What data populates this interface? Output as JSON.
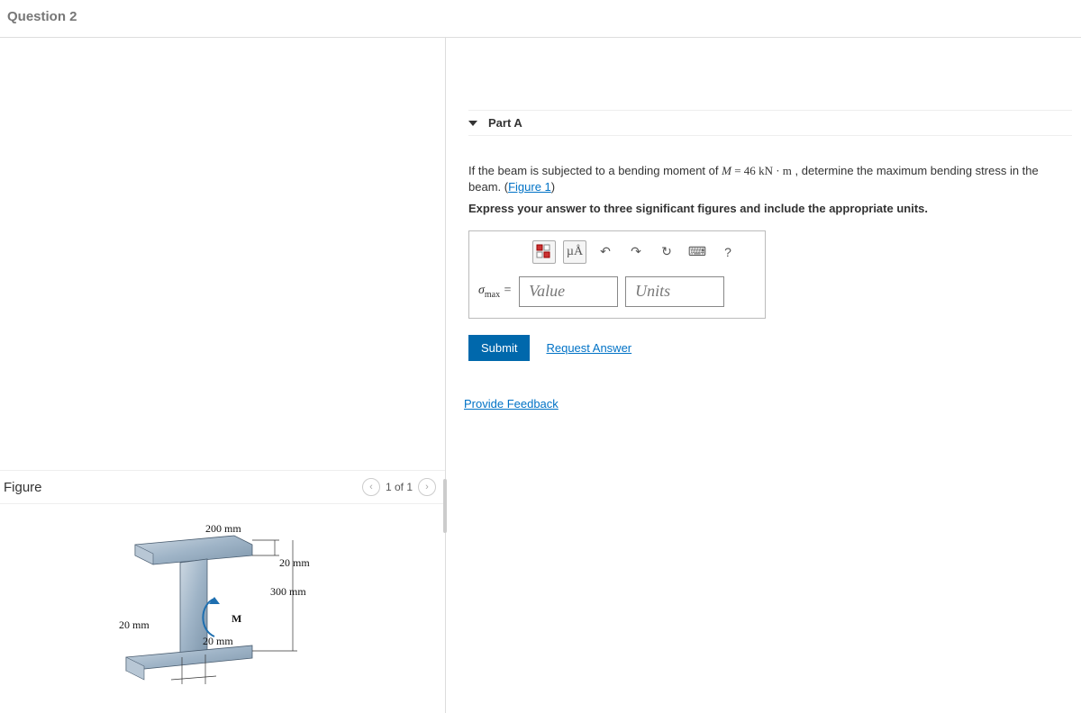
{
  "header": {
    "title": "Question 2"
  },
  "figure": {
    "title": "Figure",
    "pager": {
      "label": "1 of 1"
    },
    "dims": {
      "top_flange_width": "200 mm",
      "top_flange_thick": "20 mm",
      "web_height": "300 mm",
      "web_thick": "20 mm",
      "bottom_flange_left": "20 mm",
      "moment_label": "M"
    }
  },
  "part": {
    "title": "Part A",
    "prompt_pre": "If the beam is subjected to a bending moment of ",
    "prompt_M": "M",
    "prompt_eq": " = 46 ",
    "prompt_units": "kN · m",
    "prompt_post": " , determine the maximum bending stress in the beam. ",
    "figure_link": "Figure 1",
    "instruction": "Express your answer to three significant figures and include the appropriate units.",
    "sigma": "σ",
    "sigma_sub": "max",
    "equals": " = ",
    "value_placeholder": "Value",
    "units_placeholder": "Units",
    "toolbar": {
      "units_btn": "µÅ",
      "undo": "↶",
      "redo": "↷",
      "reset": "↻",
      "keyboard": "⌨",
      "help": "?"
    },
    "submit": "Submit",
    "request_answer": "Request Answer",
    "feedback": "Provide Feedback"
  }
}
